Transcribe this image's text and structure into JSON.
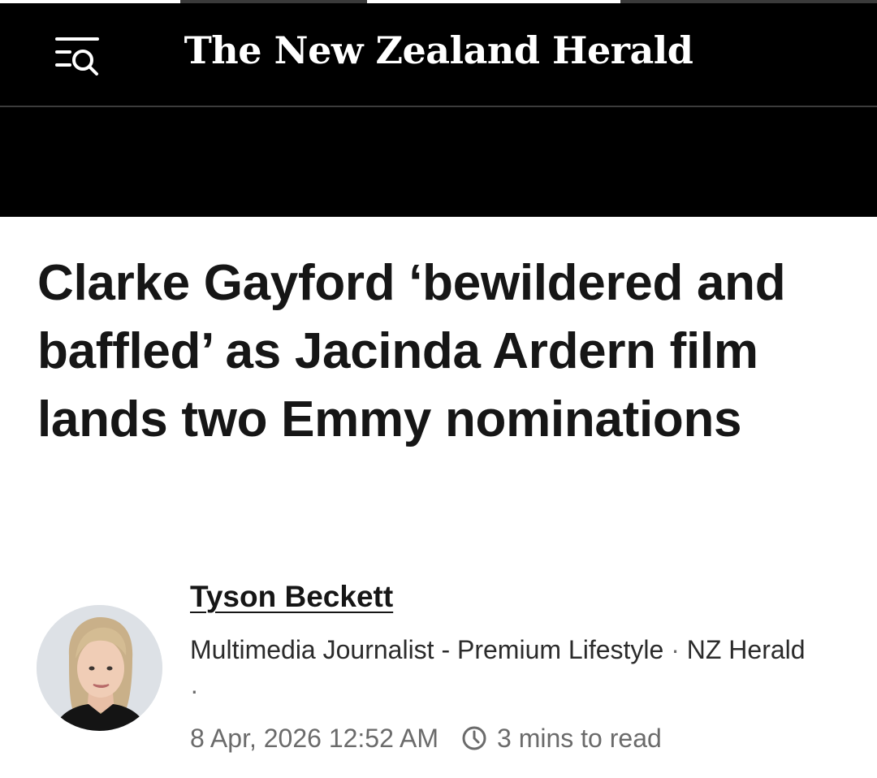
{
  "header": {
    "logo_text": "The New Zealand Herald",
    "menu_icon": "menu-search-icon"
  },
  "article": {
    "headline": "Clarke Gayford ‘bewildered and baffled’ as Jacinda Ardern film lands two Emmy nominations",
    "author": {
      "name": "Tyson Beckett",
      "role": "Multimedia Journalist - Premium Lifestyle",
      "publication_line": "NZ Herald",
      "separator": "·"
    },
    "date": "8 Apr, 2026 12:52 AM",
    "read_time": "3 mins to read",
    "read_time_icon": "clock-icon"
  },
  "colors": {
    "header_bg": "#000000",
    "page_bg": "#ffffff",
    "headline": "#161616",
    "meta_text": "#6b6b6b"
  }
}
